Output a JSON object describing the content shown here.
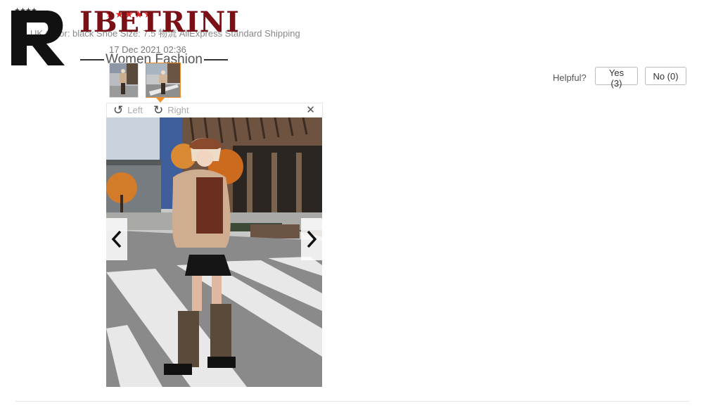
{
  "review": {
    "stars": "★★★★★",
    "tiny_stars": "★★★★",
    "meta": "UK   Color: black   Shoe Size: 7.5   物流 AliExpress Standard Shipping",
    "date": "17 Dec 2021 02:36"
  },
  "brand": {
    "name": "IBETRINI",
    "tagline": "Women Fashion"
  },
  "viewer": {
    "rotate_left": "Left",
    "rotate_right": "Right",
    "close": "✕"
  },
  "helpful": {
    "label": "Helpful?",
    "yes": "Yes (3)",
    "no": "No (0)"
  },
  "colors": {
    "brand": "#7a0f16",
    "selected_thumb": "#f0902a",
    "stars": "#e02020"
  }
}
